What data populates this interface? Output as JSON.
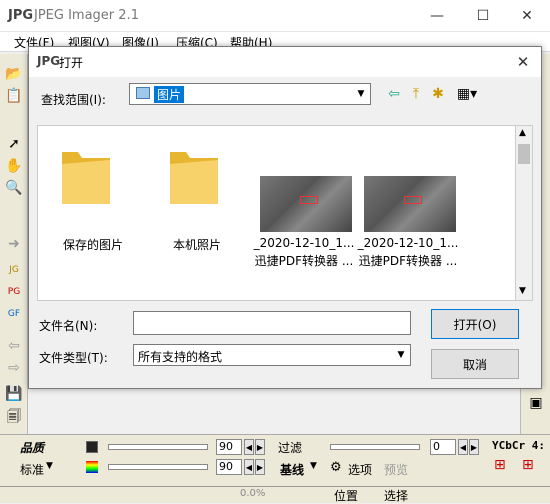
{
  "app": {
    "title": "JPEG Imager 2.1",
    "icon_text": "JPG",
    "minimize": "—",
    "maximize": "☐",
    "close": "✕"
  },
  "menu": [
    "文件(F)",
    "视图(V)",
    "图像(I)",
    "压缩(C)",
    "帮助(H)"
  ],
  "dialog": {
    "title": "打开",
    "close": "✕",
    "look_in_label": "查找范围(I):",
    "look_in_value": "图片",
    "items": [
      {
        "type": "folder",
        "name": "保存的图片"
      },
      {
        "type": "folder",
        "name": "本机照片"
      },
      {
        "type": "image",
        "line1": "_2020-12-10_1...",
        "line2": "迅捷PDF转换器 ..."
      },
      {
        "type": "image",
        "line1": "_2020-12-10_1...",
        "line2": "迅捷PDF转换器 ..."
      }
    ],
    "filename_label": "文件名(N):",
    "filename_value": "",
    "filetype_label": "文件类型(T):",
    "filetype_value": "所有支持的格式",
    "open_button": "打开(O)",
    "cancel_button": "取消"
  },
  "bottom": {
    "quality_label": "品质",
    "standard_label": "标准",
    "quality_value1": "90",
    "quality_value2": "90",
    "filter_label": "过滤",
    "filter_value": "0",
    "baseline_label": "基线",
    "options_label": "选项",
    "preview_label": "预览",
    "color_space": "YCbCr 4:",
    "status_value": "0.0%",
    "position_label": "位置",
    "selection_label": "选择"
  },
  "colors": {
    "accent": "#0078d7",
    "folder": "#f5c542",
    "toolbar_bg": "#ece9d8"
  }
}
